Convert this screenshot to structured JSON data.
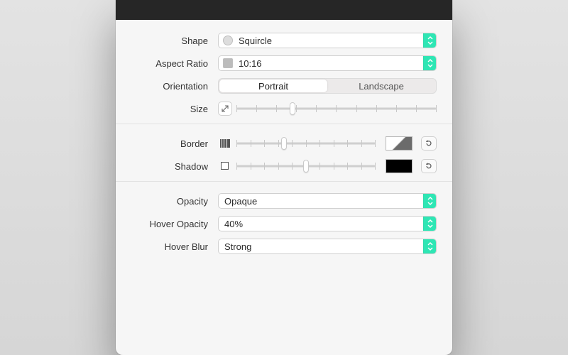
{
  "labels": {
    "shape": "Shape",
    "aspect": "Aspect Ratio",
    "orientation": "Orientation",
    "size": "Size",
    "border": "Border",
    "shadow": "Shadow",
    "opacity": "Opacity",
    "hoverOpacity": "Hover Opacity",
    "hoverBlur": "Hover Blur"
  },
  "shape": {
    "value": "Squircle"
  },
  "aspect": {
    "value": "10:16"
  },
  "orientation": {
    "options": [
      "Portrait",
      "Landscape"
    ],
    "selected": "Portrait"
  },
  "size": {
    "percent": 28,
    "ticks": 11
  },
  "border": {
    "percent": 34,
    "ticks": 11,
    "color": "gradient"
  },
  "shadow": {
    "percent": 50,
    "ticks": 11,
    "color": "#000000"
  },
  "opacity": {
    "value": "Opaque"
  },
  "hoverOpacity": {
    "value": "40%"
  },
  "hoverBlur": {
    "value": "Strong"
  },
  "accent": "#2ee6b4"
}
